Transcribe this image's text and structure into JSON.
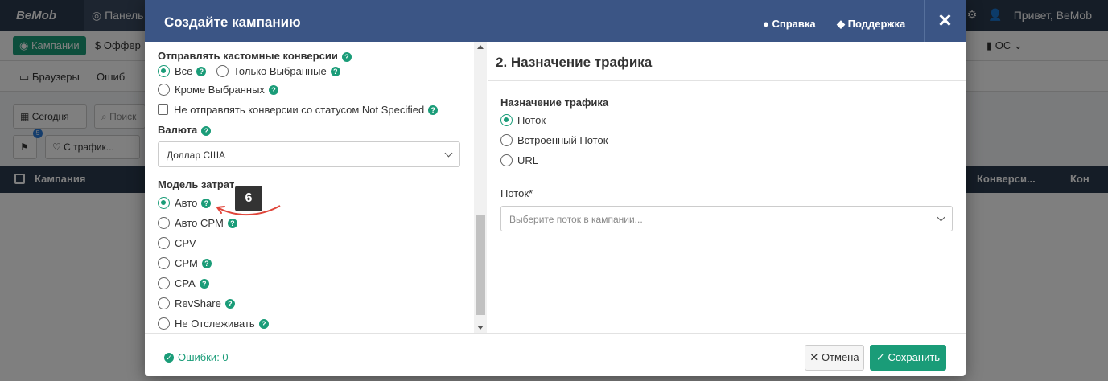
{
  "app": {
    "logo": "BeMob",
    "tab": "Панель У",
    "greeting": "Привет, BeMob",
    "nav_campaigns": "Кампании",
    "nav_offers": "Оффер",
    "nav_os": "ОС",
    "nav_browsers": "Браузеры",
    "nav_errors": "Ошиб",
    "filter_today": "Сегодня",
    "search_placeholder": "Поиск",
    "traffic_filter": "С трафик...",
    "badge_count": "5",
    "col_campaign": "Кампания",
    "col_conversions": "Конверси...",
    "col_conversions_2": "Кон"
  },
  "modal": {
    "title": "Создайте кампанию",
    "help": "Справка",
    "support": "Поддержка",
    "close": "✕"
  },
  "left": {
    "custom_conv_label": "Отправлять кастомные конверсии",
    "custom_conv_options": [
      "Все",
      "Только Выбранные",
      "Кроме Выбранных"
    ],
    "not_specified_checkbox": "Не отправлять конверсии со статусом Not Specified",
    "currency_label": "Валюта",
    "currency_value": "Доллар США",
    "cost_model_label": "Модель затрат",
    "cost_model_options": [
      "Авто",
      "Авто CPM",
      "CPV",
      "CPM",
      "CPA",
      "RevShare",
      "Не Отслеживать"
    ],
    "step_badge": "6"
  },
  "right": {
    "section_title": "2. Назначение трафика",
    "destination_label": "Назначение трафика",
    "destination_options": [
      "Поток",
      "Встроенный Поток",
      "URL"
    ],
    "flow_label": "Поток*",
    "flow_placeholder": "Выберите поток в кампании..."
  },
  "footer": {
    "errors": "Ошибки: 0",
    "cancel": "Отмена",
    "save": "Сохранить"
  },
  "colors": {
    "accent": "#1a9c78",
    "header": "#3b5585",
    "annotation_arrow": "#e0453a"
  }
}
